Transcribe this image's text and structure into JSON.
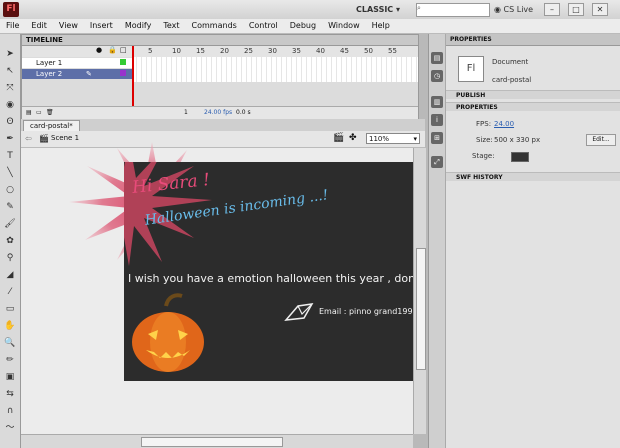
{
  "app": {
    "logo": "Fl",
    "workspace": "CLASSIC",
    "search_placeholder": "",
    "cs_live": "CS Live"
  },
  "menu": [
    "File",
    "Edit",
    "View",
    "Insert",
    "Modify",
    "Text",
    "Commands",
    "Control",
    "Debug",
    "Window",
    "Help"
  ],
  "timeline": {
    "tab": "TIMELINE",
    "frame_numbers": [
      "5",
      "10",
      "15",
      "20",
      "25",
      "30",
      "35",
      "40",
      "45",
      "50",
      "55"
    ],
    "layers": [
      "Layer 1",
      "Layer 2"
    ],
    "status": {
      "frame": "1",
      "fps": "24.00 fps",
      "time": "0.0 s"
    }
  },
  "document": {
    "tab": "card-postal*",
    "scene": "Scene 1",
    "zoom": "110%"
  },
  "stage_content": {
    "greeting": "Hi Sara !",
    "headline": "Halloween is incoming ...!",
    "message": "I wish you have a emotion halloween this year , don't forget instructi",
    "email": "Email : pinno grand1998@"
  },
  "properties": {
    "tab": "PROPERTIES",
    "doc_icon": "Fl",
    "doc_type": "Document",
    "doc_name": "card-postal",
    "publish": "PUBLISH",
    "section": "PROPERTIES",
    "fps_label": "FPS:",
    "fps_value": "24.00",
    "size_label": "Size:",
    "size_value": "500 x 330 px",
    "edit": "Edit...",
    "stage_label": "Stage:",
    "stage_color": "#333333",
    "swf": "SWF HISTORY"
  }
}
